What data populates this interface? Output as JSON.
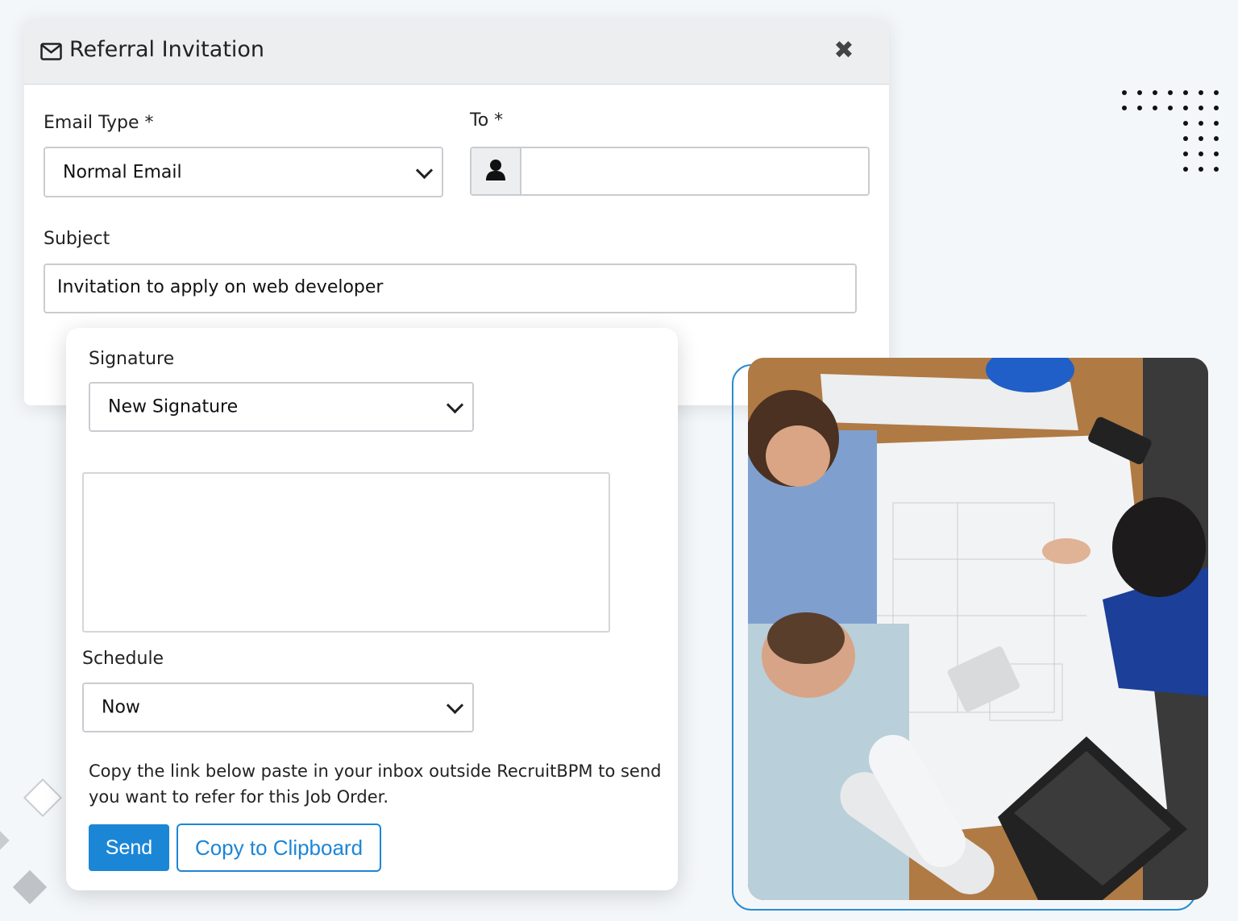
{
  "modal": {
    "title": "Referral Invitation",
    "email_type_label": "Email Type *",
    "email_type_value": "Normal Email",
    "to_label": "To *",
    "to_value": "",
    "subject_label": "Subject",
    "subject_value": "Invitation to apply on web developer"
  },
  "card": {
    "signature_label": "Signature",
    "signature_value": "New Signature",
    "signature_body": "",
    "schedule_label": "Schedule",
    "schedule_value": "Now",
    "help_text": "Copy the link below paste in your inbox outside RecruitBPM to send you want to refer for this Job Order.",
    "send_label": "Send",
    "copy_label": "Copy to Clipboard"
  },
  "colors": {
    "primary": "#1c86d6",
    "header_bg": "#eceef0"
  },
  "icons": {
    "title_icon": "envelope-icon",
    "close": "close-icon",
    "to_addon": "user-icon"
  }
}
